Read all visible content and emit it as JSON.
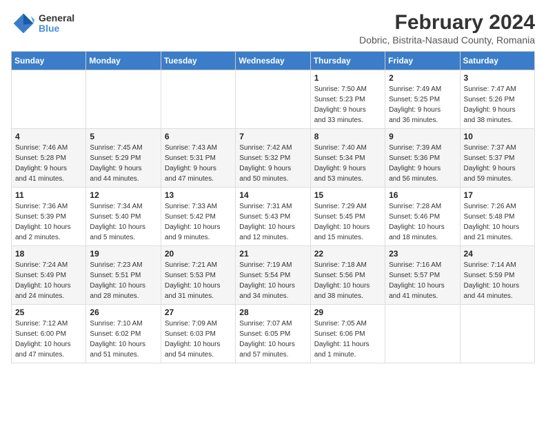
{
  "logo": {
    "line1": "General",
    "line2": "Blue"
  },
  "title": "February 2024",
  "location": "Dobric, Bistrita-Nasaud County, Romania",
  "weekdays": [
    "Sunday",
    "Monday",
    "Tuesday",
    "Wednesday",
    "Thursday",
    "Friday",
    "Saturday"
  ],
  "weeks": [
    [
      {
        "day": "",
        "info": ""
      },
      {
        "day": "",
        "info": ""
      },
      {
        "day": "",
        "info": ""
      },
      {
        "day": "",
        "info": ""
      },
      {
        "day": "1",
        "info": "Sunrise: 7:50 AM\nSunset: 5:23 PM\nDaylight: 9 hours\nand 33 minutes."
      },
      {
        "day": "2",
        "info": "Sunrise: 7:49 AM\nSunset: 5:25 PM\nDaylight: 9 hours\nand 36 minutes."
      },
      {
        "day": "3",
        "info": "Sunrise: 7:47 AM\nSunset: 5:26 PM\nDaylight: 9 hours\nand 38 minutes."
      }
    ],
    [
      {
        "day": "4",
        "info": "Sunrise: 7:46 AM\nSunset: 5:28 PM\nDaylight: 9 hours\nand 41 minutes."
      },
      {
        "day": "5",
        "info": "Sunrise: 7:45 AM\nSunset: 5:29 PM\nDaylight: 9 hours\nand 44 minutes."
      },
      {
        "day": "6",
        "info": "Sunrise: 7:43 AM\nSunset: 5:31 PM\nDaylight: 9 hours\nand 47 minutes."
      },
      {
        "day": "7",
        "info": "Sunrise: 7:42 AM\nSunset: 5:32 PM\nDaylight: 9 hours\nand 50 minutes."
      },
      {
        "day": "8",
        "info": "Sunrise: 7:40 AM\nSunset: 5:34 PM\nDaylight: 9 hours\nand 53 minutes."
      },
      {
        "day": "9",
        "info": "Sunrise: 7:39 AM\nSunset: 5:36 PM\nDaylight: 9 hours\nand 56 minutes."
      },
      {
        "day": "10",
        "info": "Sunrise: 7:37 AM\nSunset: 5:37 PM\nDaylight: 9 hours\nand 59 minutes."
      }
    ],
    [
      {
        "day": "11",
        "info": "Sunrise: 7:36 AM\nSunset: 5:39 PM\nDaylight: 10 hours\nand 2 minutes."
      },
      {
        "day": "12",
        "info": "Sunrise: 7:34 AM\nSunset: 5:40 PM\nDaylight: 10 hours\nand 5 minutes."
      },
      {
        "day": "13",
        "info": "Sunrise: 7:33 AM\nSunset: 5:42 PM\nDaylight: 10 hours\nand 9 minutes."
      },
      {
        "day": "14",
        "info": "Sunrise: 7:31 AM\nSunset: 5:43 PM\nDaylight: 10 hours\nand 12 minutes."
      },
      {
        "day": "15",
        "info": "Sunrise: 7:29 AM\nSunset: 5:45 PM\nDaylight: 10 hours\nand 15 minutes."
      },
      {
        "day": "16",
        "info": "Sunrise: 7:28 AM\nSunset: 5:46 PM\nDaylight: 10 hours\nand 18 minutes."
      },
      {
        "day": "17",
        "info": "Sunrise: 7:26 AM\nSunset: 5:48 PM\nDaylight: 10 hours\nand 21 minutes."
      }
    ],
    [
      {
        "day": "18",
        "info": "Sunrise: 7:24 AM\nSunset: 5:49 PM\nDaylight: 10 hours\nand 24 minutes."
      },
      {
        "day": "19",
        "info": "Sunrise: 7:23 AM\nSunset: 5:51 PM\nDaylight: 10 hours\nand 28 minutes."
      },
      {
        "day": "20",
        "info": "Sunrise: 7:21 AM\nSunset: 5:53 PM\nDaylight: 10 hours\nand 31 minutes."
      },
      {
        "day": "21",
        "info": "Sunrise: 7:19 AM\nSunset: 5:54 PM\nDaylight: 10 hours\nand 34 minutes."
      },
      {
        "day": "22",
        "info": "Sunrise: 7:18 AM\nSunset: 5:56 PM\nDaylight: 10 hours\nand 38 minutes."
      },
      {
        "day": "23",
        "info": "Sunrise: 7:16 AM\nSunset: 5:57 PM\nDaylight: 10 hours\nand 41 minutes."
      },
      {
        "day": "24",
        "info": "Sunrise: 7:14 AM\nSunset: 5:59 PM\nDaylight: 10 hours\nand 44 minutes."
      }
    ],
    [
      {
        "day": "25",
        "info": "Sunrise: 7:12 AM\nSunset: 6:00 PM\nDaylight: 10 hours\nand 47 minutes."
      },
      {
        "day": "26",
        "info": "Sunrise: 7:10 AM\nSunset: 6:02 PM\nDaylight: 10 hours\nand 51 minutes."
      },
      {
        "day": "27",
        "info": "Sunrise: 7:09 AM\nSunset: 6:03 PM\nDaylight: 10 hours\nand 54 minutes."
      },
      {
        "day": "28",
        "info": "Sunrise: 7:07 AM\nSunset: 6:05 PM\nDaylight: 10 hours\nand 57 minutes."
      },
      {
        "day": "29",
        "info": "Sunrise: 7:05 AM\nSunset: 6:06 PM\nDaylight: 11 hours\nand 1 minute."
      },
      {
        "day": "",
        "info": ""
      },
      {
        "day": "",
        "info": ""
      }
    ]
  ]
}
